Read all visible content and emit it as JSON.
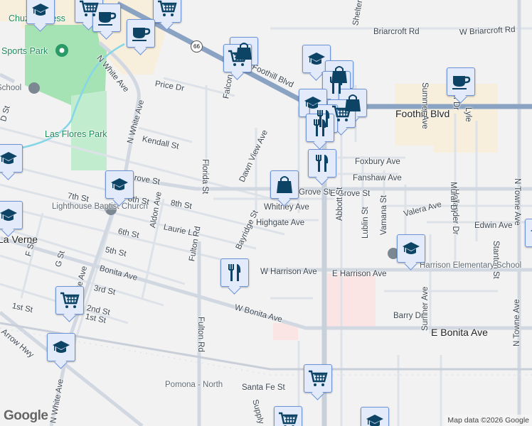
{
  "map": {
    "highway_shield": "66",
    "attribution": "Map data ©2026 Google",
    "logo": "Google",
    "labels": [
      "Chuze Fitness",
      "Sports Park",
      "School",
      "Las Flores Park",
      "Lighthouse Baptist Church",
      "La Verne",
      "N White Ave",
      "N White Ave",
      "Price Dr",
      "Kendall St",
      "Grove St",
      "7th St",
      "8th St",
      "8th St",
      "Aldon Ave",
      "Laurie Ln",
      "6th St",
      "5th St",
      "Bonita Ave",
      "3rd St",
      "2nd St",
      "1st St",
      "1st St",
      "Arrow Hwy",
      "F St",
      "G St",
      "D St",
      "N White Ave",
      "N White Ave",
      "Fulton Rd",
      "Fulton Rd",
      "Florida St",
      "Falcon",
      "Dawn View Ave",
      "Bayridge St",
      "W Bonita Ave",
      "Pomona - North",
      "Santa Fe St",
      "Supply St",
      "Foothill Blvd",
      "Foothill Blvd",
      "Shelter",
      "Briarcroft Rd",
      "W Briarcroft Rd",
      "Summer Ave",
      "Mural Dr",
      "Lyle",
      "Foxbury Ave",
      "Fanshaw Ave",
      "Grove St",
      "E Grove St",
      "Whitney Ave",
      "Highgate Ave",
      "Abbott St",
      "Lublin St",
      "Vamana St",
      "Valera Ave",
      "Edwin Ave",
      "Hollander Dr",
      "Stanton St",
      "Mural Dr",
      "Sumner Ave",
      "Harrison Elementary School",
      "W Harrison Ave",
      "E Harrison Ave",
      "Barry Dr",
      "E Bonita Ave",
      "N Towne Ave",
      "N Towne Ave"
    ],
    "markers": [
      "education",
      "shopping-cart",
      "coffee",
      "shopping-cart",
      "coffee",
      "shopping-bag",
      "shopping-cart",
      "education",
      "shopping-bag",
      "restaurant",
      "education",
      "shopping-bag",
      "shopping-cart",
      "restaurant",
      "restaurant",
      "restaurant",
      "shopping-bag",
      "education",
      "education",
      "education",
      "coffee",
      "education",
      "restaurant",
      "shopping-cart",
      "education",
      "shopping-cart",
      "shopping-cart",
      "education",
      "education"
    ],
    "colors": {
      "marker_bg": "#e3ebfb",
      "marker_border": "#6d93d9",
      "icon": "#0d4466",
      "park": "#a8e4b5",
      "highway": "#8aa3c2"
    }
  }
}
